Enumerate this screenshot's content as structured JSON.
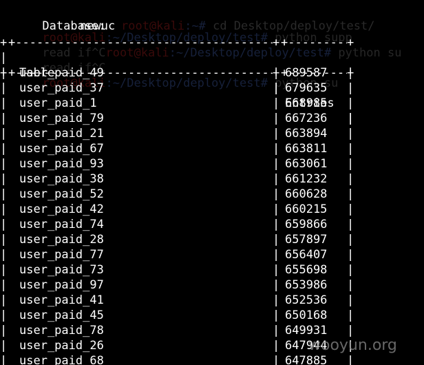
{
  "terminal": {
    "background_color": "#000000",
    "text_color": "#ffffff",
    "prompt_color": "#c0392b",
    "path_color": "#3b5ba8"
  },
  "background_lines": [
    {
      "prompt": "root@kali",
      "path": ":~#",
      "cmd": " cd Desktop/deploy/test/"
    },
    {
      "prompt": "root@kali",
      "path": ":~/Desktop/deploy/test#",
      "cmd": " python supp"
    },
    {
      "prompt": "",
      "path": "",
      "cmd": "read if^C"
    },
    {
      "prompt": "root@kali",
      "path": ":~/Desktop/deploy/test#",
      "cmd": " python su"
    },
    {
      "prompt": "",
      "path": "",
      "cmd": "read if^C"
    },
    {
      "prompt": "root@kali",
      "path": ":~/Desktop/deploy/test#",
      "cmd": " python su"
    }
  ],
  "header": {
    "database_label": "Database:",
    "database_name": "newuc"
  },
  "table": {
    "border_dashes": "+-----------------------------------------------+-------------+",
    "column_headers": {
      "name": "Table",
      "count": "Entries"
    },
    "rows": [
      {
        "name": "user_paid_49",
        "count": "689587"
      },
      {
        "name": "user_paid_37",
        "count": "679635"
      },
      {
        "name": "user_paid_1",
        "count": "668985"
      },
      {
        "name": "user_paid_79",
        "count": "667236"
      },
      {
        "name": "user_paid_21",
        "count": "663894"
      },
      {
        "name": "user_paid_67",
        "count": "663811"
      },
      {
        "name": "user_paid_93",
        "count": "663061"
      },
      {
        "name": "user_paid_38",
        "count": "661232"
      },
      {
        "name": "user_paid_52",
        "count": "660628"
      },
      {
        "name": "user_paid_42",
        "count": "660215"
      },
      {
        "name": "user_paid_74",
        "count": "659866"
      },
      {
        "name": "user_paid_28",
        "count": "657897"
      },
      {
        "name": "user_paid_77",
        "count": "656407"
      },
      {
        "name": "user_paid_73",
        "count": "655698"
      },
      {
        "name": "user_paid_97",
        "count": "653986"
      },
      {
        "name": "user_paid_41",
        "count": "652536"
      },
      {
        "name": "user_paid_45",
        "count": "650168"
      },
      {
        "name": "user_paid_78",
        "count": "649931"
      },
      {
        "name": "user_paid_26",
        "count": "647944"
      },
      {
        "name": "user_paid_68",
        "count": "647885"
      }
    ]
  },
  "watermark": {
    "text": "wooyun.org"
  }
}
